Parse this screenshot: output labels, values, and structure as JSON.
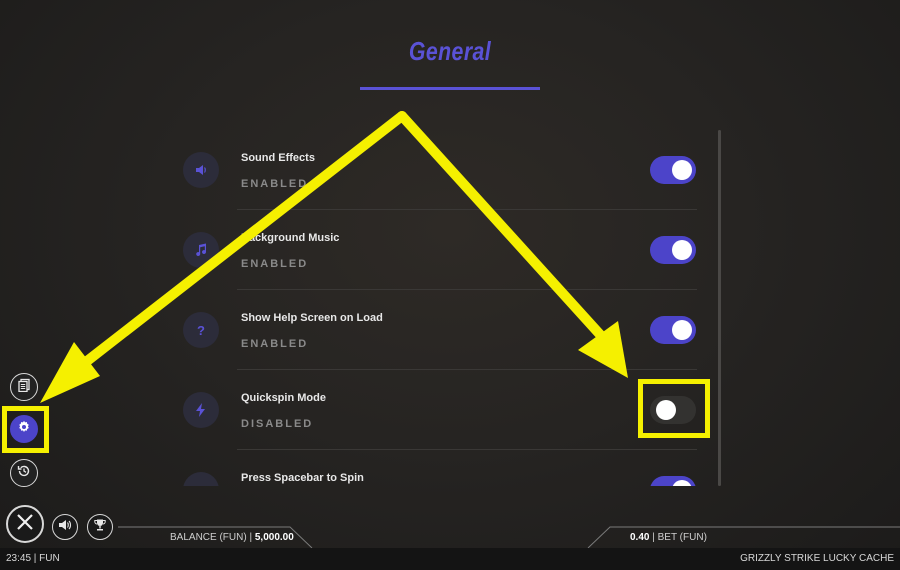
{
  "header": {
    "title": "General"
  },
  "settings": [
    {
      "icon": "speaker-icon",
      "glyph": "🔈",
      "label": "Sound Effects",
      "status": "ENABLED",
      "toggle": "on"
    },
    {
      "icon": "music-note-icon",
      "glyph": "♫",
      "label": "Background Music",
      "status": "ENABLED",
      "toggle": "on"
    },
    {
      "icon": "question-mark-icon",
      "glyph": "?",
      "label": "Show Help Screen on Load",
      "status": "ENABLED",
      "toggle": "on"
    },
    {
      "icon": "lightning-icon",
      "glyph": "⚡",
      "label": "Quickspin Mode",
      "status": "DISABLED",
      "toggle": "off"
    },
    {
      "icon": "spacebar-icon",
      "glyph": "",
      "label": "Press Spacebar to Spin",
      "status": "",
      "toggle": "on"
    }
  ],
  "sidebar": {
    "items": [
      {
        "icon": "paytable-icon"
      },
      {
        "icon": "gear-icon"
      },
      {
        "icon": "history-icon"
      }
    ]
  },
  "bottom": {
    "close_icon": "close-icon",
    "sound_icon": "speaker-icon",
    "trophy_icon": "trophy-icon",
    "balance_label": "BALANCE (FUN)",
    "balance_sep": "|",
    "balance_value": "5,000.00",
    "bet_value": "0.40",
    "bet_sep": "|",
    "bet_label": "BET  (FUN)"
  },
  "footer": {
    "time": "23:45 | FUN",
    "game_title": "GRIZZLY STRIKE LUCKY CACHE"
  },
  "colors": {
    "accent": "#4c44c9",
    "highlight": "#f5f000"
  }
}
